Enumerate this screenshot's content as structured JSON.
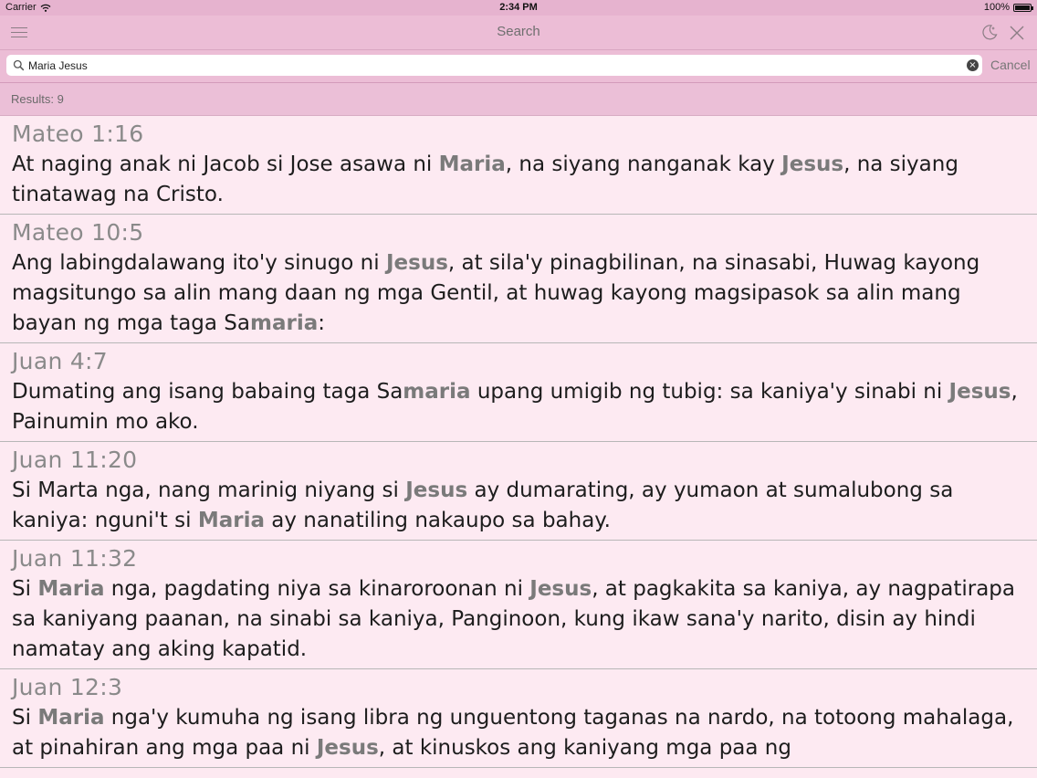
{
  "status_bar": {
    "carrier": "Carrier",
    "time": "2:34 PM",
    "battery": "100%"
  },
  "nav": {
    "title": "Search"
  },
  "search": {
    "query": "Maria Jesus",
    "cancel_label": "Cancel"
  },
  "results": {
    "summary": "Results: 9",
    "items": [
      {
        "ref": "Mateo 1:16",
        "segments": [
          {
            "t": "At naging anak ni Jacob si Jose asawa ni "
          },
          {
            "t": "Maria",
            "h": true
          },
          {
            "t": ", na siyang nanganak kay "
          },
          {
            "t": "Jesus",
            "h": true
          },
          {
            "t": ", na siyang tinatawag na Cristo."
          }
        ]
      },
      {
        "ref": "Mateo 10:5",
        "segments": [
          {
            "t": "Ang labingdalawang ito'y sinugo ni "
          },
          {
            "t": "Jesus",
            "h": true
          },
          {
            "t": ", at sila'y pinagbilinan, na sinasabi, Huwag kayong magsitungo sa alin mang daan ng mga Gentil, at huwag kayong magsipasok sa alin mang bayan ng mga taga Sa"
          },
          {
            "t": "maria",
            "h": true
          },
          {
            "t": ":"
          }
        ]
      },
      {
        "ref": "Juan 4:7",
        "segments": [
          {
            "t": "Dumating ang isang babaing taga Sa"
          },
          {
            "t": "maria",
            "h": true
          },
          {
            "t": " upang umigib ng tubig: sa kaniya'y sinabi ni "
          },
          {
            "t": "Jesus",
            "h": true
          },
          {
            "t": ", Painumin mo ako."
          }
        ]
      },
      {
        "ref": "Juan 11:20",
        "segments": [
          {
            "t": "Si Marta nga, nang marinig niyang si "
          },
          {
            "t": "Jesus",
            "h": true
          },
          {
            "t": " ay dumarating, ay yumaon at sumalubong sa kaniya: nguni't si "
          },
          {
            "t": "Maria",
            "h": true
          },
          {
            "t": " ay nanatiling nakaupo sa bahay."
          }
        ]
      },
      {
        "ref": "Juan 11:32",
        "segments": [
          {
            "t": "Si "
          },
          {
            "t": "Maria",
            "h": true
          },
          {
            "t": " nga, pagdating niya sa kinaroroonan ni "
          },
          {
            "t": "Jesus",
            "h": true
          },
          {
            "t": ", at pagkakita sa kaniya, ay nagpatirapa sa kaniyang paanan, na sinabi sa kaniya, Panginoon, kung ikaw sana'y narito, disin ay hindi namatay ang aking kapatid."
          }
        ]
      },
      {
        "ref": "Juan 12:3",
        "segments": [
          {
            "t": "Si "
          },
          {
            "t": "Maria",
            "h": true
          },
          {
            "t": " nga'y kumuha ng isang libra ng unguentong taganas na nardo, na totoong mahalaga, at pinahiran ang mga paa ni "
          },
          {
            "t": "Jesus",
            "h": true
          },
          {
            "t": ", at kinuskos ang kaniyang mga paa ng"
          }
        ]
      }
    ]
  }
}
